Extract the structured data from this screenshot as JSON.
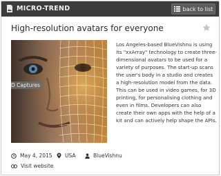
{
  "header": {
    "section_label": "MICRO-TREND",
    "back_label": "back to list"
  },
  "article": {
    "title": "High-resolution avatars for everyone",
    "image_caption": "D Captures",
    "description": "Los Angeles-based BlueVishnu is using its \"xxArray\" technology to create three-dimensional avatars to be used for a variety of purposes. The start-up scans the user's body in a studio and creates a high-resolution model from the data. This can be used in video games, for 3D printing, for personalising clothing and even in films. Developers can also create their own apps with the help of a kit and can actively help shape the APIs."
  },
  "meta": {
    "date": "May 4, 2015",
    "location": "USA",
    "author": "BlueVishnu",
    "website_label": "Visit website"
  },
  "icons": {
    "brand": "image-icon",
    "back": "list-icon",
    "favorite": "star-icon",
    "date": "clock-icon",
    "location": "map-pin-icon",
    "author": "user-icon",
    "website": "link-icon"
  },
  "colors": {
    "topbar": "#3c3c3c",
    "back_button": "#5d5d5d",
    "star": "#c4c4c4"
  }
}
